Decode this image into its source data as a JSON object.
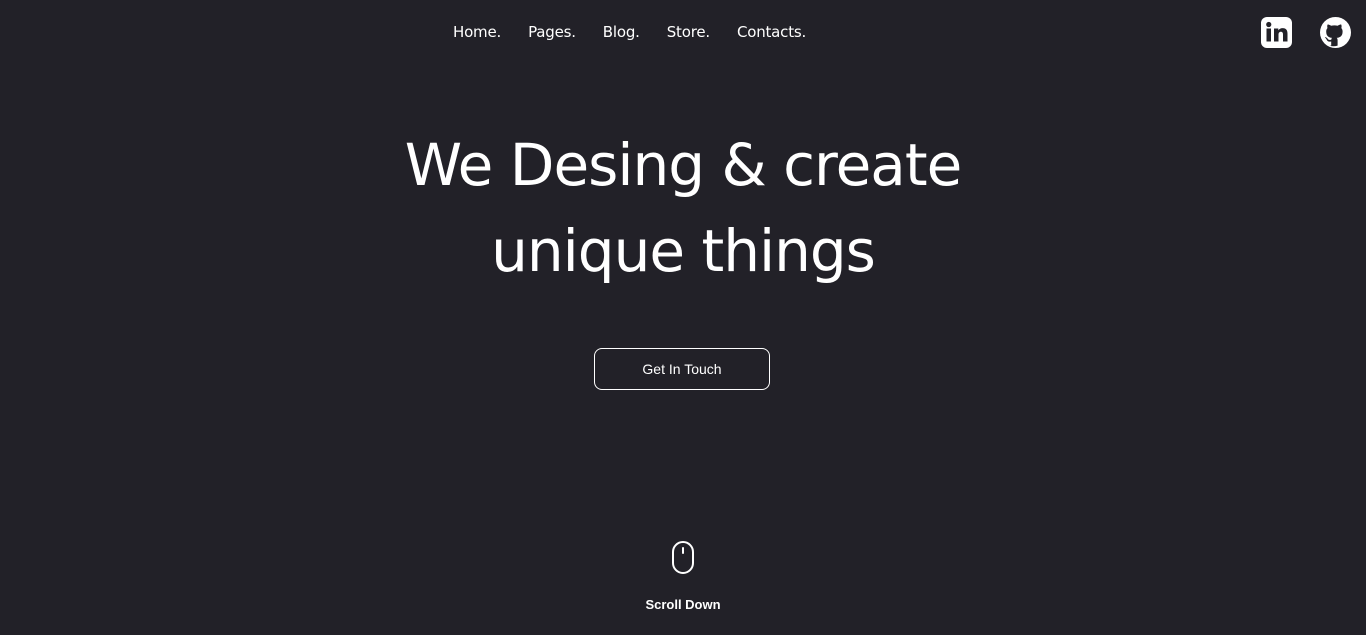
{
  "nav": {
    "items": [
      {
        "label": "Home."
      },
      {
        "label": "Pages."
      },
      {
        "label": "Blog."
      },
      {
        "label": "Store."
      },
      {
        "label": "Contacts."
      }
    ]
  },
  "social": {
    "icons": [
      "linkedin-icon",
      "github-icon"
    ]
  },
  "hero": {
    "line1": "We Desing & create",
    "line2": "unique things"
  },
  "cta": {
    "label": "Get In Touch"
  },
  "scroll": {
    "label": "Scroll Down",
    "icon": "mouse-icon"
  },
  "colors": {
    "background": "#222128",
    "text": "#ffffff"
  }
}
